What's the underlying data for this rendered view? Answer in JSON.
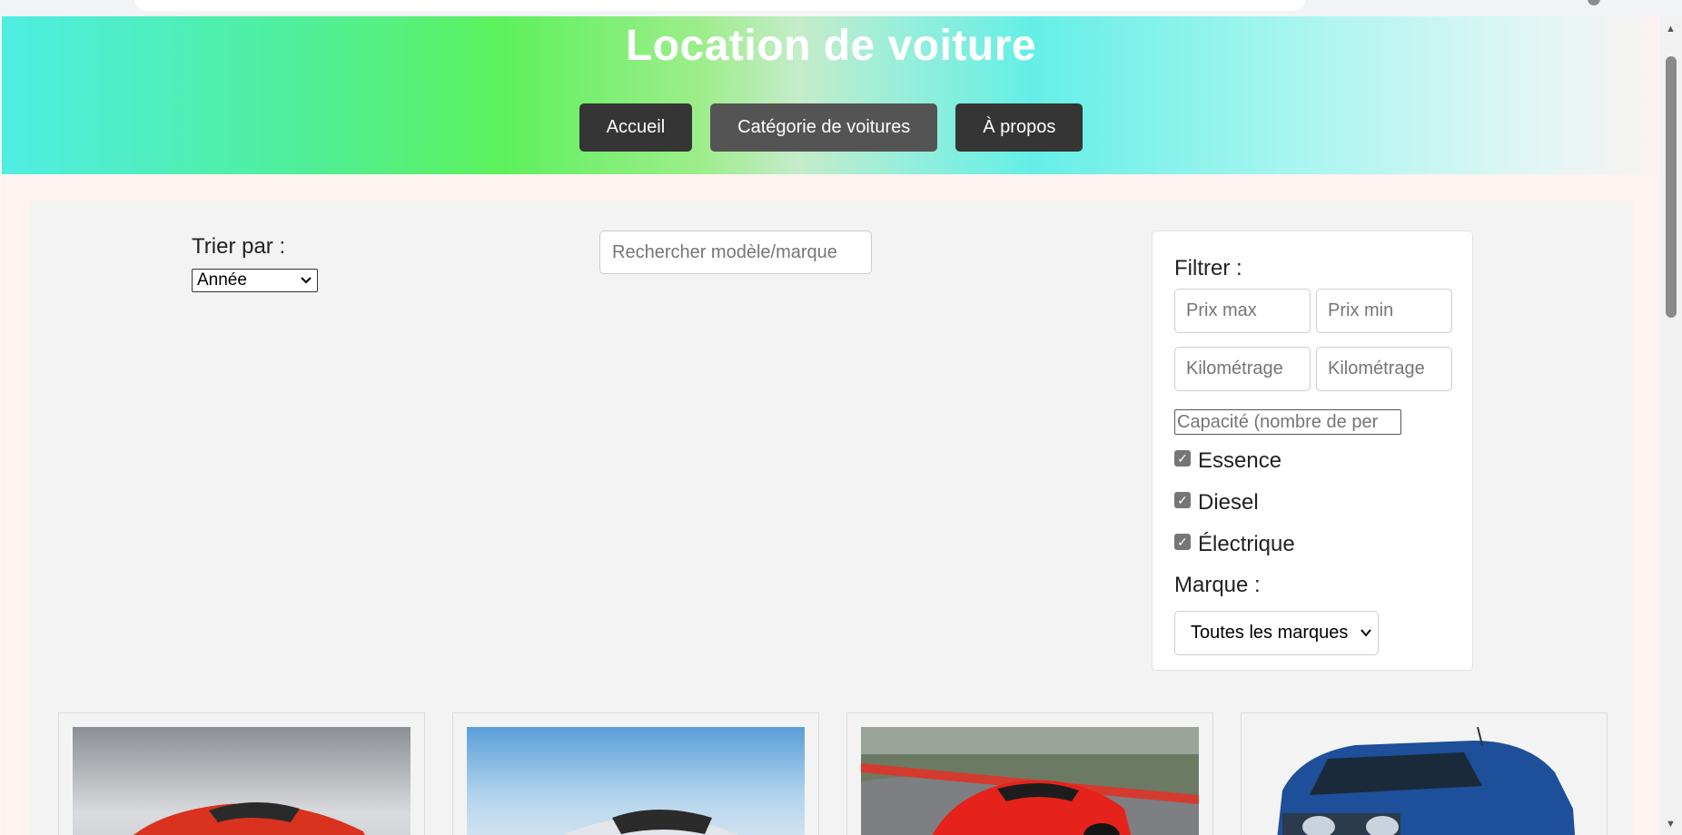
{
  "header": {
    "title": "Location de voiture",
    "nav": [
      {
        "label": "Accueil"
      },
      {
        "label": "Catégorie de voitures"
      },
      {
        "label": "À propos"
      }
    ]
  },
  "sort": {
    "label": "Trier par :",
    "selected": "Année"
  },
  "search": {
    "placeholder": "Rechercher modèle/marque"
  },
  "filters": {
    "title": "Filtrer :",
    "prix_max_placeholder": "Prix max",
    "prix_min_placeholder": "Prix min",
    "km_max_placeholder": "Kilométrage",
    "km_min_placeholder": "Kilométrage",
    "capacity_placeholder": "Capacité (nombre de per",
    "fuel": [
      {
        "label": "Essence",
        "checked": true
      },
      {
        "label": "Diesel",
        "checked": true
      },
      {
        "label": "Électrique",
        "checked": true
      }
    ],
    "marque_label": "Marque :",
    "marque_selected": "Toutes les marques"
  },
  "cars": [
    {
      "image": "red-sports-car"
    },
    {
      "image": "white-electric-hatchback"
    },
    {
      "image": "red-supercar-on-track"
    },
    {
      "image": "blue-pickup-truck"
    }
  ],
  "colors": {
    "nav_button": "#353535",
    "nav_button_active": "#545454",
    "panel_background": "#f3f3f3"
  }
}
